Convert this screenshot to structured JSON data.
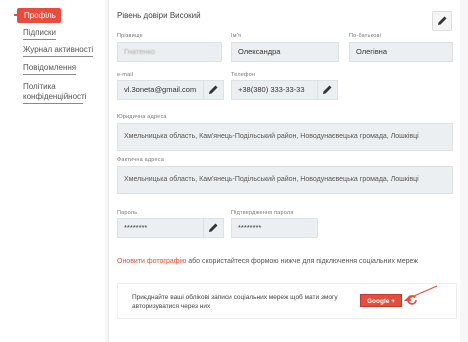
{
  "sidebar": {
    "items": [
      {
        "label": "Профіль",
        "active": true
      },
      {
        "label": "Підписки"
      },
      {
        "label": "Журнал активності"
      },
      {
        "label": "Повідомлення"
      },
      {
        "label": "Політика конфіденційності"
      }
    ]
  },
  "profile": {
    "trust_level": "Рівень довіри Високий",
    "fields": {
      "surname": {
        "label": "Прізвище",
        "value": "Гнатенко"
      },
      "first_name": {
        "label": "Ім'я",
        "value": "Олександра"
      },
      "patronymic": {
        "label": "По-батькові",
        "value": "Олегівна"
      },
      "email": {
        "label": "e-mail",
        "value": "vl.3oneta@gmail.com"
      },
      "phone": {
        "label": "Телефон",
        "value": "+38(380) 333-33-33"
      },
      "legal_address": {
        "label": "Юридична адреса",
        "value": "Хмельницька область, Кам'янець-Подільський район, Новодунаєвецька громада, Лошківці"
      },
      "actual_address": {
        "label": "Фактична адреса",
        "value": "Хмельницька область, Кам'янець-Подільський район, Новодунаєвецька громада, Лошківці"
      },
      "password": {
        "label": "Пароль",
        "value": "********"
      },
      "password_confirm": {
        "label": "Підтвердження пароля",
        "value": "********"
      }
    },
    "photo_link": "Оновити фотографію",
    "photo_text": " або скористайтеся формою нижче для підключення соціальних мереж",
    "social_text": "Приєднайте ваші облікові записи соціальних мереж щоб мати змогу авторизуватися через них",
    "google_button": "Google +"
  },
  "colors": {
    "accent": "#e74c3c",
    "field_bg": "#eceff1"
  },
  "icons": [
    "pencil-icon",
    "refresh-icon",
    "arrow-icon"
  ]
}
